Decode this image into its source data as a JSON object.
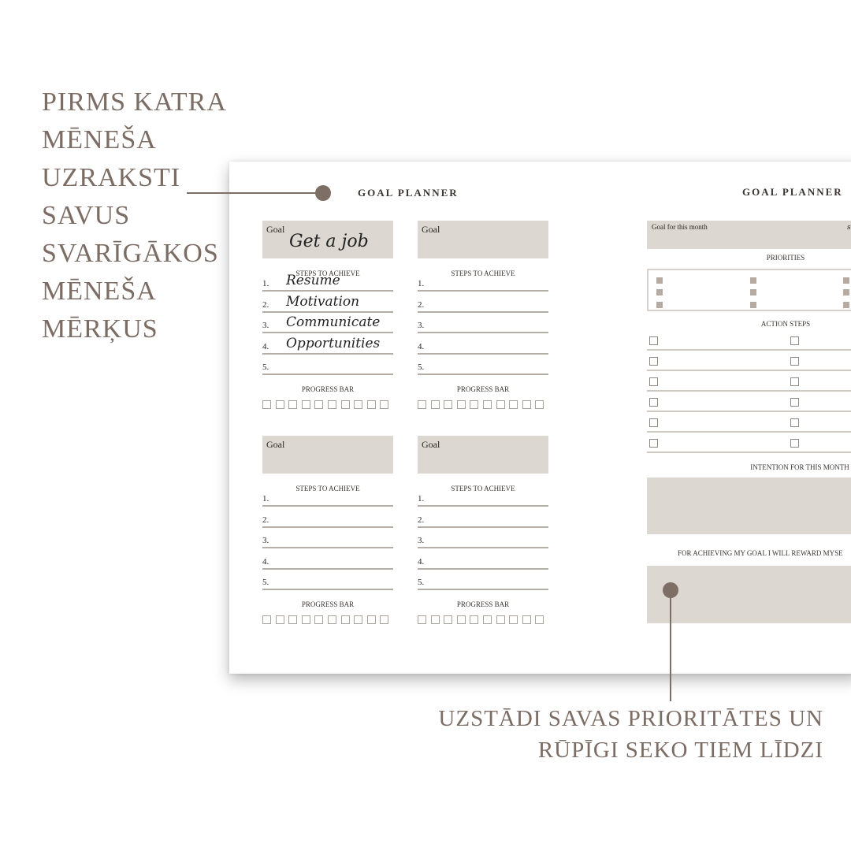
{
  "left_callout": [
    "PIRMS KATRA",
    "MĒNEŠA",
    "UZRAKSTI",
    "SAVUS",
    "SVARĪGĀKOS",
    "MĒNEŠA",
    "MĒRĶUS"
  ],
  "bottom_callout": [
    "UZSTĀDI SAVAS PRIORITĀTES UN",
    "RŪPĪGI SEKO TIEM LĪDZI"
  ],
  "left_page": {
    "title": "GOAL PLANNER",
    "goals": [
      {
        "label": "Goal",
        "value": "Get a job",
        "steps_label": "STEPS TO ACHIEVE",
        "steps": [
          "Resume",
          "Motivation",
          "Communicate",
          "Opportunities",
          ""
        ],
        "progress_label": "PROGRESS BAR",
        "progress_boxes": 10,
        "progress_filled": 0
      },
      {
        "label": "Goal",
        "value": "",
        "steps_label": "STEPS TO ACHIEVE",
        "steps": [
          "",
          "",
          "",
          "",
          ""
        ],
        "progress_label": "PROGRESS BAR",
        "progress_boxes": 10,
        "progress_filled": 0
      },
      {
        "label": "Goal",
        "value": "",
        "steps_label": "STEPS TO ACHIEVE",
        "steps": [
          "",
          "",
          "",
          "",
          ""
        ],
        "progress_label": "PROGRESS BAR",
        "progress_boxes": 10,
        "progress_filled": 0
      },
      {
        "label": "Goal",
        "value": "",
        "steps_label": "STEPS TO ACHIEVE",
        "steps": [
          "",
          "",
          "",
          "",
          ""
        ],
        "progress_label": "PROGRESS BAR",
        "progress_boxes": 10,
        "progress_filled": 0
      }
    ],
    "step_numbers": [
      "1.",
      "2.",
      "3.",
      "4.",
      "5."
    ]
  },
  "right_page": {
    "title": "GOAL PLANNER",
    "goal_for_month": "Goal for this month",
    "goal_cut_text": "s",
    "priorities": "PRIORITIES",
    "action_steps": "ACTION STEPS",
    "intention": "INTENTION FOR THIS MONTH",
    "reward": "FOR ACHIEVING MY GOAL I WILL REWARD MYSE"
  },
  "colors": {
    "accent": "#7d6e66",
    "box": "#dcd8d1",
    "bullet": "#b6aaa1"
  }
}
